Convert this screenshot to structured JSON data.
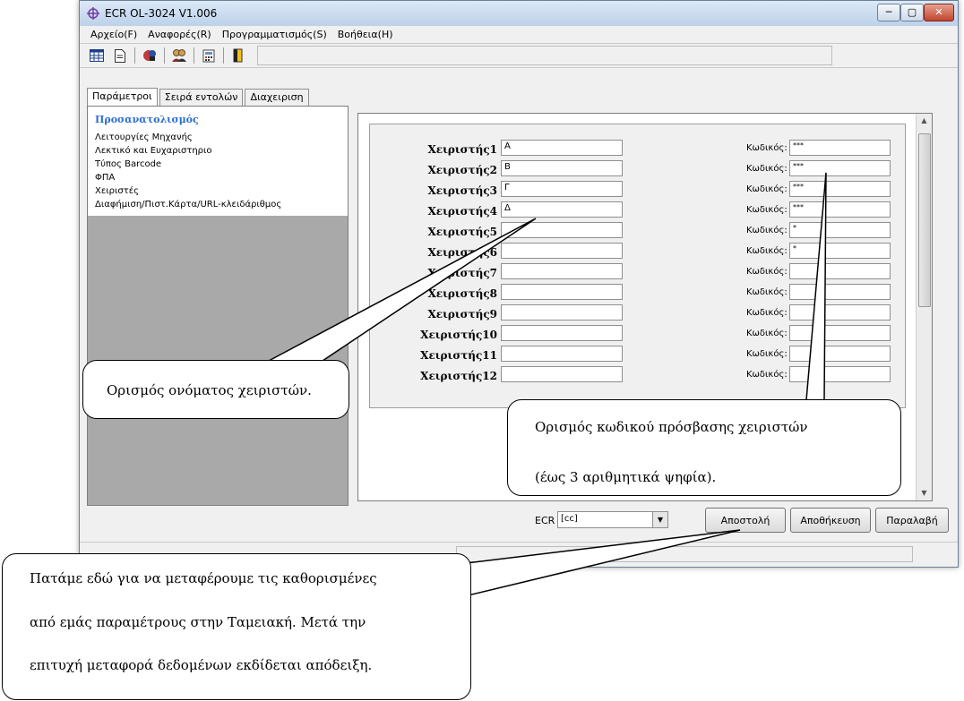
{
  "window": {
    "title": "ECR OL-3024 V1.006",
    "min": "─",
    "max": "▢",
    "close": "✕"
  },
  "menu": [
    "Αρχείο(F)",
    "Αναφορές(R)",
    "Προγραμματισμός(S)",
    "Βοήθεια(H)"
  ],
  "tabs": [
    "Παράμετροι",
    "Σειρά εντολών",
    "Διαχειριση"
  ],
  "nav": {
    "title": "Προσανατολισμός",
    "items": [
      "Λειτουργίες Μηχανής",
      "Λεκτικό και Ευχαριστηριο",
      "Τύπος Barcode",
      "ΦΠΑ",
      "Χειριστές",
      "Διαφήμιση/Πιστ.Κάρτα/URL-κλειδάριθμος"
    ]
  },
  "operators": [
    {
      "label": "Χειριστής1",
      "name": "Α",
      "pw_label": "Κωδικός:",
      "pw": "***"
    },
    {
      "label": "Χειριστής2",
      "name": "Β",
      "pw_label": "Κωδικός:",
      "pw": "***"
    },
    {
      "label": "Χειριστής3",
      "name": "Γ",
      "pw_label": "Κωδικός:",
      "pw": "***"
    },
    {
      "label": "Χειριστής4",
      "name": "Δ",
      "pw_label": "Κωδικός:",
      "pw": "***"
    },
    {
      "label": "Χειριστής5",
      "name": "",
      "pw_label": "Κωδικός:",
      "pw": "*"
    },
    {
      "label": "Χειριστής6",
      "name": "",
      "pw_label": "Κωδικός:",
      "pw": "*"
    },
    {
      "label": "Χειριστής7",
      "name": "",
      "pw_label": "Κωδικός:",
      "pw": ""
    },
    {
      "label": "Χειριστής8",
      "name": "",
      "pw_label": "Κωδικός:",
      "pw": ""
    },
    {
      "label": "Χειριστής9",
      "name": "",
      "pw_label": "Κωδικός:",
      "pw": ""
    },
    {
      "label": "Χειριστής10",
      "name": "",
      "pw_label": "Κωδικός:",
      "pw": ""
    },
    {
      "label": "Χειριστής11",
      "name": "",
      "pw_label": "Κωδικός:",
      "pw": ""
    },
    {
      "label": "Χειριστής12",
      "name": "",
      "pw_label": "Κωδικός:",
      "pw": ""
    }
  ],
  "bottom": {
    "ecr_label": "ECR",
    "ecr_value": "[cc]",
    "send": "Αποστολή",
    "save": "Αποθήκευση",
    "receive": "Παραλαβή"
  },
  "callouts": {
    "names": "Ορισμός ονόματος χειριστών.",
    "password_line1": "Ορισμός κωδικού πρόσβασης χειριστών",
    "password_line2": "(έως 3 αριθμητικά ψηφία).",
    "send_line1": "Πατάμε εδώ για να μεταφέρουμε τις καθορισμένες",
    "send_line2": "από εμάς παραμέτρους στην Ταμειακή. Μετά την",
    "send_line3": "επιτυχή μεταφορά δεδομένων εκδίδεται απόδειξη."
  },
  "icons": {
    "app": "crosshair-icon",
    "toolbar": [
      "grid-icon",
      "document-icon",
      "palette-icon",
      "users-icon",
      "calculator-icon",
      "exit-icon"
    ]
  },
  "colors": {
    "nav_title": "#2a6fd0",
    "left_panel": "#a9a9a9"
  }
}
